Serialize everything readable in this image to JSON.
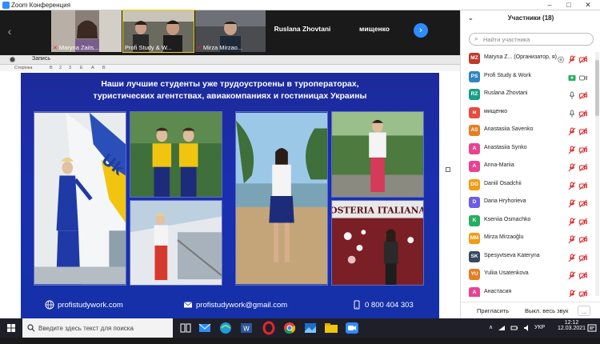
{
  "window": {
    "title": "Zoom Конференция",
    "minimize": "–",
    "maximize": "□",
    "close": "✕"
  },
  "strip": {
    "prev_arrow": "‹",
    "next_arrow": "›",
    "tiles": [
      {
        "name": "Maryna Zaits...",
        "muted": true
      },
      {
        "name": "Profi Study & W...",
        "muted": false
      },
      {
        "name": "Mirza Mirzao...",
        "muted": true
      },
      {
        "name": "Ruslana Zhovtani",
        "muted": false
      },
      {
        "name": "мищенко",
        "muted": false
      }
    ]
  },
  "recording": {
    "label": "Запись"
  },
  "toolbar_labels": [
    "Сторінка",
    "В",
    "2",
    "3",
    "Е",
    "А",
    "В"
  ],
  "slide": {
    "title_line1": "Наши лучшие студенты уже трудоустроены в туроператорах,",
    "title_line2": "туристических агентствах, авиакомпаниях и гостиницах Украины",
    "osteria_text": "OSTERIA ITALIANA",
    "footer": {
      "website": "profistudywork.com",
      "email": "profistudywork@gmail.com",
      "phone": "0 800 404 303"
    }
  },
  "participants": {
    "title": "Участники (18)",
    "collapse_icon": "chevron-down-icon",
    "search_placeholder": "Найти участника",
    "items": [
      {
        "initials": "MZ",
        "name": "Maryna Z... (Организатор, я)",
        "color": "#c0392b",
        "mic": "muted",
        "video": "off"
      },
      {
        "initials": "PS",
        "name": "Profi Study & Work",
        "color": "#2e86c1",
        "mic": "sharing",
        "video": "on"
      },
      {
        "initials": "RZ",
        "name": "Ruslana Zhovtani",
        "color": "#16a085",
        "mic": "on",
        "video": "off"
      },
      {
        "initials": "м",
        "name": "мищенко",
        "color": "#e74c3c",
        "mic": "on",
        "video": "off"
      },
      {
        "initials": "AS",
        "name": "Anastasiia Savenko",
        "color": "#e67e22",
        "mic": "muted",
        "video": "off"
      },
      {
        "initials": "A",
        "name": "Anastasiia Synko",
        "color": "#e84393",
        "mic": "muted",
        "video": "off"
      },
      {
        "initials": "A",
        "name": "Anna-Mariia",
        "color": "#e84393",
        "mic": "muted",
        "video": "off"
      },
      {
        "initials": "DO",
        "name": "Daniil Osadchii",
        "color": "#f39c12",
        "mic": "muted",
        "video": "off"
      },
      {
        "initials": "D",
        "name": "Daria Hryhorieva",
        "color": "#6c5ce7",
        "mic": "muted",
        "video": "off"
      },
      {
        "initials": "K",
        "name": "Kseniia Osmachko",
        "color": "#27ae60",
        "mic": "muted",
        "video": "off"
      },
      {
        "initials": "MM",
        "name": "Mirza Mirzaoğlu",
        "color": "#f39c12",
        "mic": "muted",
        "video": "off"
      },
      {
        "initials": "SK",
        "name": "Spesyvtseva Kateryna",
        "color": "#34495e",
        "mic": "muted",
        "video": "off"
      },
      {
        "initials": "YU",
        "name": "Yuliia Usatenkova",
        "color": "#e67e22",
        "mic": "muted",
        "video": "off"
      },
      {
        "initials": "A",
        "name": "Анастасия",
        "color": "#e84393",
        "mic": "muted",
        "video": "off"
      }
    ],
    "invite_label": "Пригласить",
    "mute_all_label": "Выкл. весь звук",
    "more_label": "..."
  },
  "taskbar": {
    "search_placeholder": "Введите здесь текст для поиска",
    "language": "УКР",
    "time": "12:12",
    "date": "12.03.2021"
  },
  "colors": {
    "zoom_blue": "#2d8cff",
    "slide_blue": "#1a2fb0",
    "muted_red": "#e02828"
  }
}
